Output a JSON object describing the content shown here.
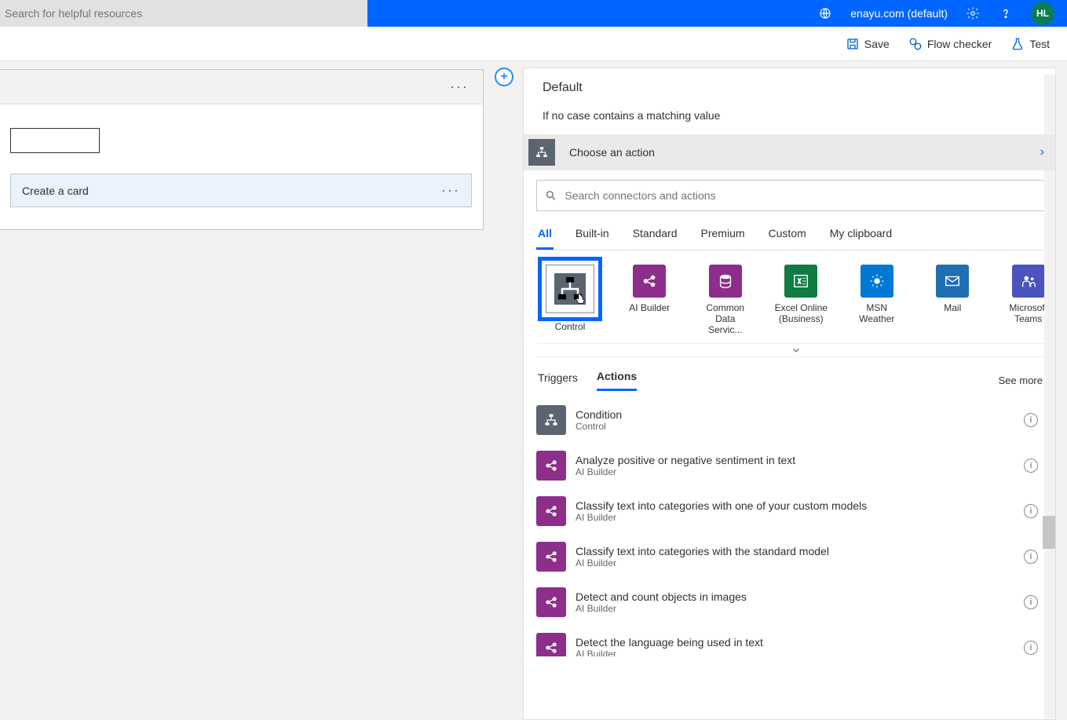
{
  "header": {
    "search_placeholder": "Search for helpful resources",
    "environment": "enayu.com (default)",
    "avatar": "HL"
  },
  "toolbar": {
    "save": "Save",
    "flow_checker": "Flow checker",
    "test": "Test"
  },
  "left_card": {
    "inner_action_label": "Create a card"
  },
  "panel": {
    "title": "Default",
    "description": "If no case contains a matching value",
    "choose_label": "Choose an action",
    "search_placeholder": "Search connectors and actions",
    "category_tabs": [
      "All",
      "Built-in",
      "Standard",
      "Premium",
      "Custom",
      "My clipboard"
    ],
    "active_category": "All",
    "connectors": [
      {
        "name": "Control",
        "color": "#5c6471",
        "icon": "flow"
      },
      {
        "name": "AI Builder",
        "color": "#8E2E8B",
        "icon": "ai"
      },
      {
        "name": "Common Data Servic...",
        "color": "#8E2E8B",
        "icon": "db"
      },
      {
        "name": "Excel Online (Business)",
        "color": "#107C41",
        "icon": "excel"
      },
      {
        "name": "MSN Weather",
        "color": "#0078D4",
        "icon": "weather"
      },
      {
        "name": "Mail",
        "color": "#1F6FB2",
        "icon": "mail"
      },
      {
        "name": "Microsoft Teams",
        "color": "#4B53BC",
        "icon": "teams"
      }
    ],
    "sub_tabs": [
      "Triggers",
      "Actions"
    ],
    "active_sub_tab": "Actions",
    "see_more": "See more",
    "actions": [
      {
        "title": "Condition",
        "subtitle": "Control",
        "color": "#5c6471",
        "icon": "flow"
      },
      {
        "title": "Analyze positive or negative sentiment in text",
        "subtitle": "AI Builder",
        "color": "#8E2E8B",
        "icon": "ai"
      },
      {
        "title": "Classify text into categories with one of your custom models",
        "subtitle": "AI Builder",
        "color": "#8E2E8B",
        "icon": "ai"
      },
      {
        "title": "Classify text into categories with the standard model",
        "subtitle": "AI Builder",
        "color": "#8E2E8B",
        "icon": "ai"
      },
      {
        "title": "Detect and count objects in images",
        "subtitle": "AI Builder",
        "color": "#8E2E8B",
        "icon": "ai"
      },
      {
        "title": "Detect the language being used in text",
        "subtitle": "AI Builder",
        "color": "#8E2E8B",
        "icon": "ai"
      }
    ]
  }
}
